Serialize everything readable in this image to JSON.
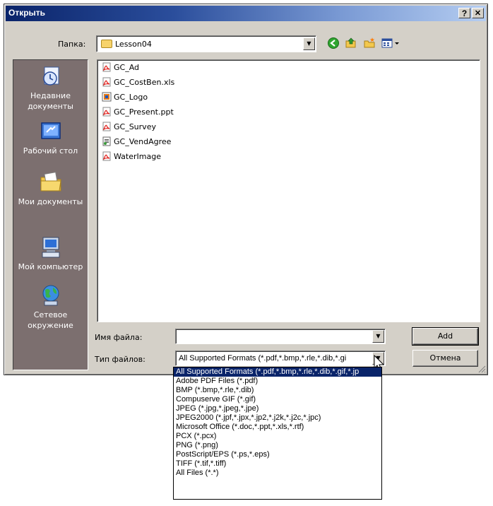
{
  "window": {
    "title": "Открыть",
    "help_btn": "?",
    "close_btn": "✕"
  },
  "toolbar": {
    "lookin_label": "Папка:",
    "lookin_value": "Lesson04"
  },
  "places": [
    {
      "label": "Недавние документы"
    },
    {
      "label": "Рабочий стол"
    },
    {
      "label": "Мои документы"
    },
    {
      "label": "Мой компьютер"
    },
    {
      "label": "Сетевое окружение"
    }
  ],
  "files": [
    {
      "name": "GC_Ad",
      "type": "pdf"
    },
    {
      "name": "GC_CostBen.xls",
      "type": "pdf"
    },
    {
      "name": "GC_Logo",
      "type": "img"
    },
    {
      "name": "GC_Present.ppt",
      "type": "pdf"
    },
    {
      "name": "GC_Survey",
      "type": "pdf"
    },
    {
      "name": "GC_VendAgree",
      "type": "doc"
    },
    {
      "name": "WaterImage",
      "type": "pdf"
    }
  ],
  "form": {
    "filename_label": "Имя файла:",
    "filename_value": "",
    "filetype_label": "Тип файлов:",
    "filetype_value": "All Supported Formats (*.pdf,*.bmp,*.rle,*.dib,*.gi",
    "add_button": "Add",
    "cancel_button": "Отмена"
  },
  "filetype_options": [
    {
      "label": "All Supported Formats (*.pdf,*.bmp,*.rle,*.dib,*.gif,*.jp",
      "selected": true
    },
    {
      "label": "Adobe PDF Files (*.pdf)"
    },
    {
      "label": "BMP (*.bmp,*.rle,*.dib)"
    },
    {
      "label": "Compuserve GIF (*.gif)"
    },
    {
      "label": "JPEG (*.jpg,*.jpeg,*.jpe)"
    },
    {
      "label": "JPEG2000 (*.jpf,*.jpx,*.jp2,*.j2k,*.j2c,*.jpc)"
    },
    {
      "label": "Microsoft Office (*.doc,*.ppt,*.xls,*.rtf)"
    },
    {
      "label": "PCX (*.pcx)"
    },
    {
      "label": "PNG (*.png)"
    },
    {
      "label": "PostScript/EPS (*.ps,*.eps)"
    },
    {
      "label": "TIFF (*.tif,*.tiff)"
    },
    {
      "label": "All Files (*.*)"
    }
  ],
  "colors": {
    "title_bar_start": "#0a246a",
    "title_bar_end": "#b5cdf1",
    "places_bg": "#7c6f6f",
    "selection": "#0a246a",
    "dialog_bg": "#d4d0c8"
  },
  "icons": {
    "back": "back-arrow-icon",
    "up": "folder-up-icon",
    "new_folder": "new-folder-icon",
    "views": "view-menu-icon"
  }
}
